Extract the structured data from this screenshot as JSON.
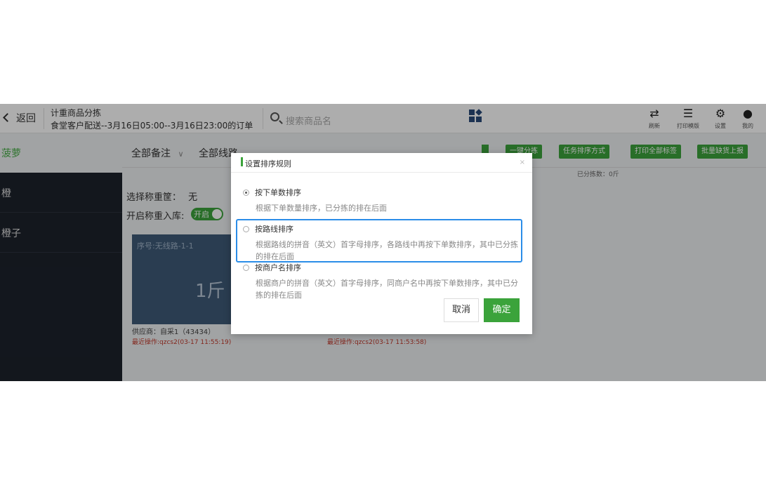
{
  "header": {
    "back_label": "返回",
    "title": "计重商品分拣",
    "subtitle": "食堂客户配送--3月16日05:00--3月16日23:00的订单",
    "search_placeholder": "搜索商品名",
    "buttons": [
      {
        "label": "刷新",
        "icon": "refresh-icon"
      },
      {
        "label": "打印模版",
        "icon": "print-template-icon"
      },
      {
        "label": "设置",
        "icon": "gear-icon"
      },
      {
        "label": "我的",
        "icon": "user-icon"
      }
    ]
  },
  "sidebar": {
    "category": "菠萝",
    "items": [
      {
        "label": "橙"
      },
      {
        "label": "橙子"
      }
    ]
  },
  "filters": {
    "remark": "全部备注",
    "route": "全部线路"
  },
  "actions": {
    "batch_pick": "一键分拣",
    "task_sort": "任务排序方式",
    "print_all": "打印全部标签",
    "batch_report": "批量缺货上报"
  },
  "status": {
    "sorted": "已分拣数：0斤"
  },
  "scale": {
    "label": "选择称重筐：",
    "value": "无",
    "inbound_label": "开启称重入库:",
    "toggle_text": "开启",
    "toggle_on": true
  },
  "card": {
    "seq": "序号:无线路-1-1",
    "weight": "1斤",
    "supplier": "供应商：自采1（43434）",
    "recent_left": "最近操作:qzcs2(03-17 11:55:19)",
    "recent_right": "最近操作:qzcs2(03-17 11:53:58)"
  },
  "modal": {
    "title": "设置排序规则",
    "close": "×",
    "options": [
      {
        "label": "按下单数排序",
        "desc": "根据下单数量排序，已分拣的排在后面",
        "selected": true
      },
      {
        "label": "按路线排序",
        "desc": "根据路线的拼音（英文）首字母排序，各路线中再按下单数排序，其中已分拣的排在后面",
        "selected": false
      },
      {
        "label": "按商户名排序",
        "desc": "根据商户的拼音（英文）首字母排序，同商户名中再按下单数排序，其中已分拣的排在后面",
        "selected": false
      }
    ],
    "cancel": "取消",
    "confirm": "确定"
  },
  "colors": {
    "accent_green": "#3ba33b",
    "highlight_blue": "#2b8de8",
    "sidebar_bg": "#1c222c",
    "card_bg": "#3f5a78",
    "warning_red": "#c0392b"
  }
}
